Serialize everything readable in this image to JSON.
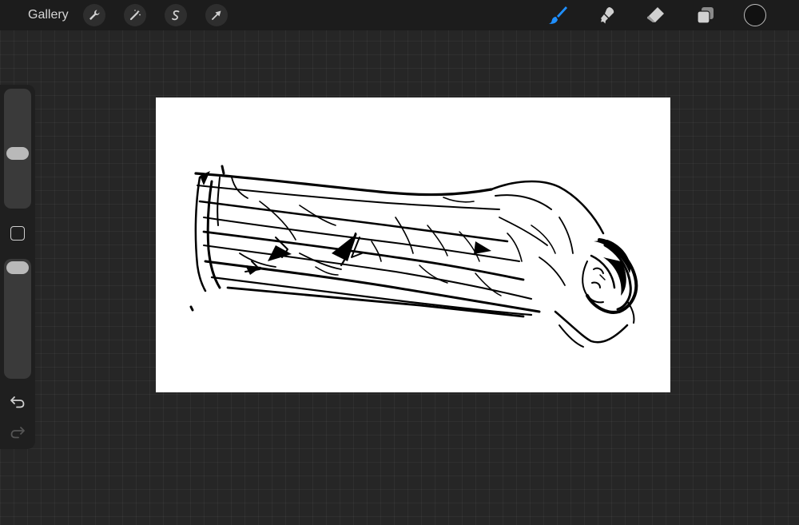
{
  "toolbar": {
    "gallery_label": "Gallery",
    "left_tools": [
      {
        "name": "actions",
        "icon": "wrench-icon"
      },
      {
        "name": "adjustments",
        "icon": "magic-wand-icon"
      },
      {
        "name": "selection",
        "icon": "selection-s-icon"
      },
      {
        "name": "transform",
        "icon": "arrow-cursor-icon"
      }
    ],
    "right_tools": [
      {
        "name": "brush",
        "icon": "brush-icon",
        "active": true
      },
      {
        "name": "smudge",
        "icon": "smudge-icon",
        "active": false
      },
      {
        "name": "eraser",
        "icon": "eraser-icon",
        "active": false
      },
      {
        "name": "layers",
        "icon": "layers-icon",
        "active": false
      }
    ],
    "current_color": "#111111"
  },
  "sidebar": {
    "brush_size_level": 0.55,
    "opacity_level": 0.0,
    "modify_icon": "square-icon",
    "undo_icon": "undo-icon",
    "redo_icon": "redo-icon",
    "redo_enabled": false
  },
  "canvas": {
    "background": "#ffffff",
    "artwork": "sketch-figure"
  },
  "colors": {
    "accent": "#1f8fff",
    "toolbar_bg": "#1c1c1c",
    "workspace_bg": "#262626"
  }
}
